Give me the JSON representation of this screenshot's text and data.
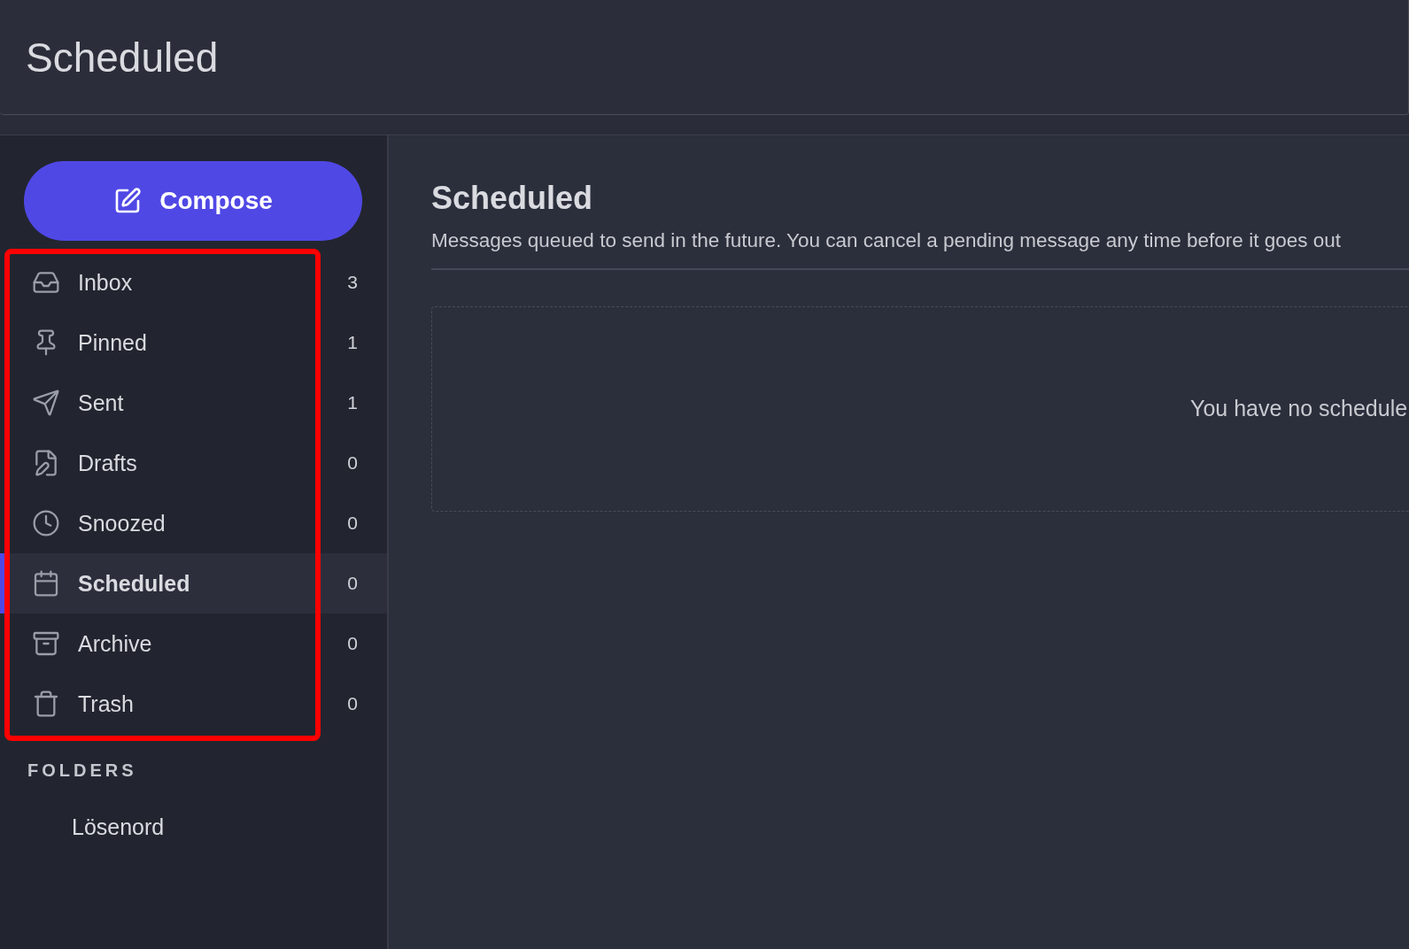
{
  "header": {
    "title": "Scheduled"
  },
  "sidebar": {
    "compose": {
      "label": "Compose"
    },
    "nav": {
      "highlighted": true,
      "items": [
        {
          "kind": "inbox",
          "label": "Inbox",
          "count": "3",
          "selected": false
        },
        {
          "kind": "pinned",
          "label": "Pinned",
          "count": "1",
          "selected": false
        },
        {
          "kind": "sent",
          "label": "Sent",
          "count": "1",
          "selected": false
        },
        {
          "kind": "drafts",
          "label": "Drafts",
          "count": "0",
          "selected": false
        },
        {
          "kind": "snoozed",
          "label": "Snoozed",
          "count": "0",
          "selected": false
        },
        {
          "kind": "scheduled",
          "label": "Scheduled",
          "count": "0",
          "selected": true
        },
        {
          "kind": "archive",
          "label": "Archive",
          "count": "0",
          "selected": false
        },
        {
          "kind": "trash",
          "label": "Trash",
          "count": "0",
          "selected": false
        }
      ]
    },
    "folders": {
      "heading": "FOLDERS",
      "items": [
        {
          "label": "Lösenord"
        }
      ]
    }
  },
  "main": {
    "title": "Scheduled",
    "description": "Messages queued to send in the future. You can cancel a pending message any time before it goes out",
    "empty_state": "You have no schedule"
  }
}
